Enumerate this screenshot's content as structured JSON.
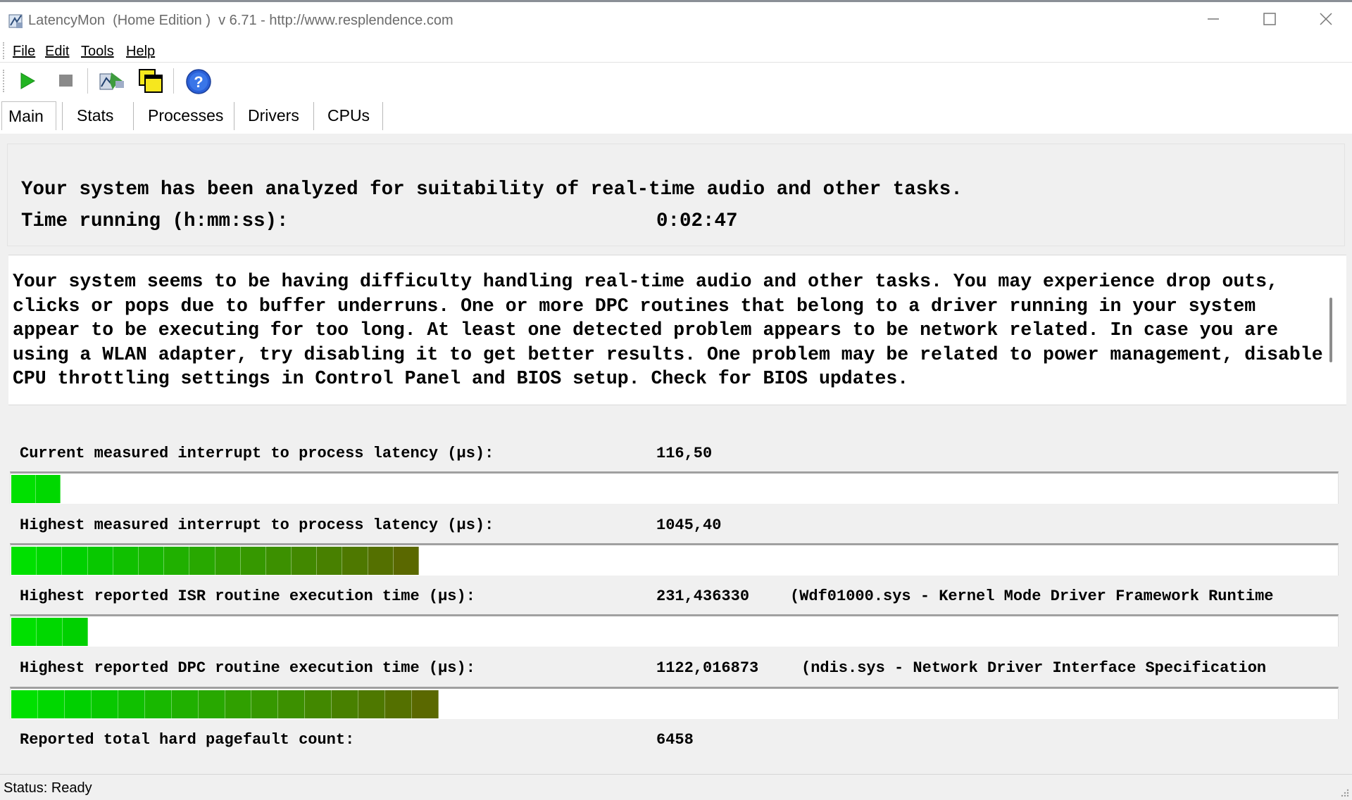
{
  "window": {
    "title": "LatencyMon  (Home Edition )  v 6.71 - http://www.resplendence.com",
    "icons": [
      "latencymon-app-icon",
      "minimize-icon",
      "maximize-icon",
      "close-icon"
    ]
  },
  "menu": {
    "items": [
      {
        "label": "File",
        "accel": "F"
      },
      {
        "label": "Edit",
        "accel": "E"
      },
      {
        "label": "Tools",
        "accel": "T"
      },
      {
        "label": "Help",
        "accel": "H"
      }
    ]
  },
  "toolbar": {
    "buttons": [
      "start-icon",
      "stop-icon",
      "report-icon",
      "windows-icon",
      "help-icon"
    ],
    "colors": {
      "play": "#22b422",
      "stop": "#8a8a8a",
      "help": "#2a5fd6"
    }
  },
  "tabs": [
    {
      "label": "Main",
      "active": true
    },
    {
      "label": "Stats",
      "active": false
    },
    {
      "label": "Processes",
      "active": false
    },
    {
      "label": "Drivers",
      "active": false
    },
    {
      "label": "CPUs",
      "active": false
    }
  ],
  "summary": {
    "line1": "Your system has been analyzed for suitability of real-time audio and other tasks.",
    "time_label": "Time running (h:mm:ss):",
    "time_value": "0:02:47"
  },
  "message": "Your system seems to be having difficulty handling real-time audio and other tasks. You may experience drop outs, clicks or pops due to buffer underruns. One or more DPC routines that belong to a driver running in your system appear to be executing for too long. At least one detected problem appears to be network related. In case you are using a WLAN adapter, try disabling it to get better results. One problem may be related to power management, disable CPU throttling settings in Control Panel and BIOS setup. Check for BIOS updates.",
  "metrics": [
    {
      "label": "Current measured interrupt to process latency (µs):",
      "value": "116,50",
      "extra": "",
      "bar_segments": 2,
      "bar_fraction": 0.037
    },
    {
      "label": "Highest measured interrupt to process latency (µs):",
      "value": "1045,40",
      "extra": "",
      "bar_segments": 16,
      "bar_fraction": 0.307
    },
    {
      "label": "Highest reported ISR routine execution time (µs):",
      "value": "231,436330",
      "extra": "(Wdf01000.sys - Kernel Mode Driver Framework Runtime",
      "bar_segments": 3,
      "bar_fraction": 0.058
    },
    {
      "label": "Highest reported DPC routine execution time (µs):",
      "value": "1122,016873",
      "extra": "(ndis.sys - Network Driver Interface Specification",
      "bar_segments": 16,
      "bar_fraction": 0.322
    },
    {
      "label": "Reported total hard pagefault count:",
      "value": "6458",
      "extra": "",
      "bar_segments": 0,
      "bar_fraction": 0
    }
  ],
  "bar_colors": [
    "#00e000",
    "#00d800",
    "#00d000",
    "#08c800",
    "#10c000",
    "#18b800",
    "#20b000",
    "#28a800",
    "#30a000",
    "#369800",
    "#3c9000",
    "#428800",
    "#488000",
    "#4e7800",
    "#547000",
    "#5a6800"
  ],
  "status": {
    "text": "Status: Ready"
  }
}
